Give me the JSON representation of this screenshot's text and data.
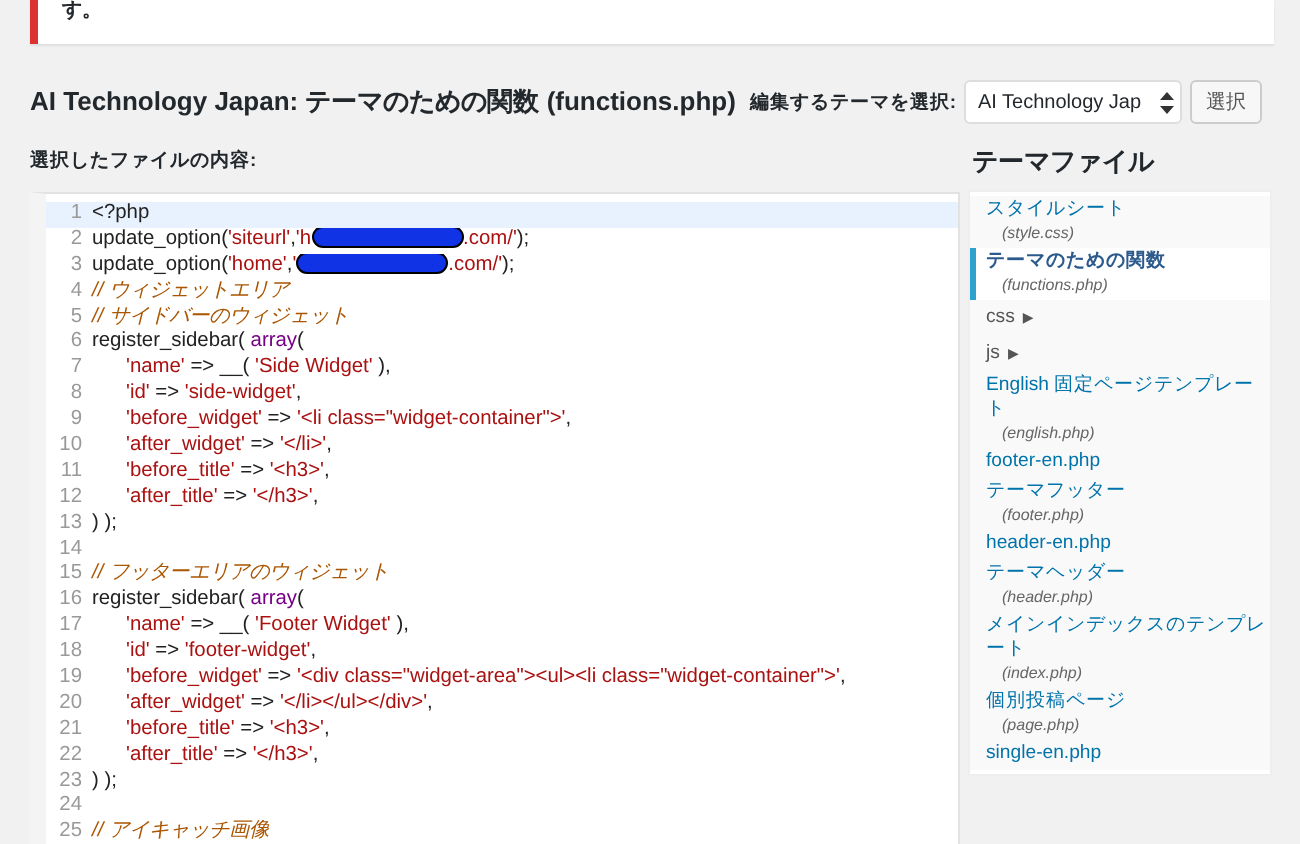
{
  "notice": {
    "text": "す。"
  },
  "title": "AI Technology Japan: テーマのための関数 (functions.php)",
  "theme_select": {
    "label": "編集するテーマを選択:",
    "value": "AI Technology Jap",
    "button": "選択"
  },
  "content_label": "選択したファイルの内容:",
  "editor": {
    "lines": [
      {
        "number": "1",
        "active": true,
        "indent": false,
        "segments": [
          {
            "kind": "plain",
            "text": "<?php"
          }
        ]
      },
      {
        "number": "2",
        "active": false,
        "indent": false,
        "segments": [
          {
            "kind": "plain",
            "text": "update_option("
          },
          {
            "kind": "string",
            "text": "'siteurl'"
          },
          {
            "kind": "plain",
            "text": ","
          },
          {
            "kind": "string",
            "text": "'h"
          },
          {
            "kind": "redaction"
          },
          {
            "kind": "string",
            "text": ".com/'"
          },
          {
            "kind": "plain",
            "text": ");"
          }
        ]
      },
      {
        "number": "3",
        "active": false,
        "indent": false,
        "segments": [
          {
            "kind": "plain",
            "text": "update_option("
          },
          {
            "kind": "string",
            "text": "'home'"
          },
          {
            "kind": "plain",
            "text": ","
          },
          {
            "kind": "string",
            "text": "'"
          },
          {
            "kind": "redaction"
          },
          {
            "kind": "string",
            "text": ".com/'"
          },
          {
            "kind": "plain",
            "text": ");"
          }
        ]
      },
      {
        "number": "4",
        "active": false,
        "indent": false,
        "segments": [
          {
            "kind": "comment",
            "text": "// ウィジェットエリア"
          }
        ]
      },
      {
        "number": "5",
        "active": false,
        "indent": false,
        "segments": [
          {
            "kind": "comment",
            "text": "// サイドバーのウィジェット"
          }
        ]
      },
      {
        "number": "6",
        "active": false,
        "indent": false,
        "segments": [
          {
            "kind": "plain",
            "text": "register_sidebar( "
          },
          {
            "kind": "keyword",
            "text": "array"
          },
          {
            "kind": "plain",
            "text": "("
          }
        ]
      },
      {
        "number": "7",
        "active": false,
        "indent": true,
        "segments": [
          {
            "kind": "string",
            "text": "'name'"
          },
          {
            "kind": "plain",
            "text": " => __( "
          },
          {
            "kind": "string",
            "text": "'Side Widget'"
          },
          {
            "kind": "plain",
            "text": " ),"
          }
        ]
      },
      {
        "number": "8",
        "active": false,
        "indent": true,
        "segments": [
          {
            "kind": "string",
            "text": "'id'"
          },
          {
            "kind": "plain",
            "text": " => "
          },
          {
            "kind": "string",
            "text": "'side-widget'"
          },
          {
            "kind": "plain",
            "text": ","
          }
        ]
      },
      {
        "number": "9",
        "active": false,
        "indent": true,
        "segments": [
          {
            "kind": "string",
            "text": "'before_widget'"
          },
          {
            "kind": "plain",
            "text": " => "
          },
          {
            "kind": "string",
            "text": "'<li class=\"widget-container\">'"
          },
          {
            "kind": "plain",
            "text": ","
          }
        ]
      },
      {
        "number": "10",
        "active": false,
        "indent": true,
        "segments": [
          {
            "kind": "string",
            "text": "'after_widget'"
          },
          {
            "kind": "plain",
            "text": " => "
          },
          {
            "kind": "string",
            "text": "'</li>'"
          },
          {
            "kind": "plain",
            "text": ","
          }
        ]
      },
      {
        "number": "11",
        "active": false,
        "indent": true,
        "segments": [
          {
            "kind": "string",
            "text": "'before_title'"
          },
          {
            "kind": "plain",
            "text": " => "
          },
          {
            "kind": "string",
            "text": "'<h3>'"
          },
          {
            "kind": "plain",
            "text": ","
          }
        ]
      },
      {
        "number": "12",
        "active": false,
        "indent": true,
        "segments": [
          {
            "kind": "string",
            "text": "'after_title'"
          },
          {
            "kind": "plain",
            "text": " => "
          },
          {
            "kind": "string",
            "text": "'</h3>'"
          },
          {
            "kind": "plain",
            "text": ","
          }
        ]
      },
      {
        "number": "13",
        "active": false,
        "indent": false,
        "segments": [
          {
            "kind": "plain",
            "text": ") );"
          }
        ]
      },
      {
        "number": "14",
        "active": false
      },
      {
        "number": "15",
        "active": false,
        "indent": false,
        "segments": [
          {
            "kind": "comment",
            "text": "// フッターエリアのウィジェット"
          }
        ]
      },
      {
        "number": "16",
        "active": false,
        "indent": false,
        "segments": [
          {
            "kind": "plain",
            "text": "register_sidebar( "
          },
          {
            "kind": "keyword",
            "text": "array"
          },
          {
            "kind": "plain",
            "text": "("
          }
        ]
      },
      {
        "number": "17",
        "active": false,
        "indent": true,
        "segments": [
          {
            "kind": "string",
            "text": "'name'"
          },
          {
            "kind": "plain",
            "text": " => __( "
          },
          {
            "kind": "string",
            "text": "'Footer Widget'"
          },
          {
            "kind": "plain",
            "text": " ),"
          }
        ]
      },
      {
        "number": "18",
        "active": false,
        "indent": true,
        "segments": [
          {
            "kind": "string",
            "text": "'id'"
          },
          {
            "kind": "plain",
            "text": " => "
          },
          {
            "kind": "string",
            "text": "'footer-widget'"
          },
          {
            "kind": "plain",
            "text": ","
          }
        ]
      },
      {
        "number": "19",
        "active": false,
        "indent": true,
        "segments": [
          {
            "kind": "string",
            "text": "'before_widget'"
          },
          {
            "kind": "plain",
            "text": " => "
          },
          {
            "kind": "string",
            "text": "'<div class=\"widget-area\"><ul><li class=\"widget-container\">'"
          },
          {
            "kind": "plain",
            "text": ","
          }
        ]
      },
      {
        "number": "20",
        "active": false,
        "indent": true,
        "segments": [
          {
            "kind": "string",
            "text": "'after_widget'"
          },
          {
            "kind": "plain",
            "text": " => "
          },
          {
            "kind": "string",
            "text": "'</li></ul></div>'"
          },
          {
            "kind": "plain",
            "text": ","
          }
        ]
      },
      {
        "number": "21",
        "active": false,
        "indent": true,
        "segments": [
          {
            "kind": "string",
            "text": "'before_title'"
          },
          {
            "kind": "plain",
            "text": " => "
          },
          {
            "kind": "string",
            "text": "'<h3>'"
          },
          {
            "kind": "plain",
            "text": ","
          }
        ]
      },
      {
        "number": "22",
        "active": false,
        "indent": true,
        "segments": [
          {
            "kind": "string",
            "text": "'after_title'"
          },
          {
            "kind": "plain",
            "text": " => "
          },
          {
            "kind": "string",
            "text": "'</h3>'"
          },
          {
            "kind": "plain",
            "text": ","
          }
        ]
      },
      {
        "number": "23",
        "active": false,
        "indent": false,
        "segments": [
          {
            "kind": "plain",
            "text": ") );"
          }
        ]
      },
      {
        "number": "24",
        "active": false
      },
      {
        "number": "25",
        "active": false,
        "indent": false,
        "segments": [
          {
            "kind": "comment",
            "text": "// アイキャッチ画像"
          }
        ]
      }
    ]
  },
  "theme_files": {
    "title": "テーマファイル",
    "items": [
      {
        "kind": "file",
        "label": "スタイルシート",
        "filename": "(style.css)",
        "selected": false
      },
      {
        "kind": "file",
        "label": "テーマのための関数",
        "filename": "(functions.php)",
        "selected": true
      },
      {
        "kind": "folder",
        "label": "css",
        "arrow": "▶",
        "selected": false
      },
      {
        "kind": "folder",
        "label": "js",
        "arrow": "▶",
        "selected": false
      },
      {
        "kind": "file",
        "label": "English 固定ページテンプレート",
        "filename": "(english.php)",
        "selected": false
      },
      {
        "kind": "file",
        "label": "footer-en.php",
        "selected": false
      },
      {
        "kind": "file",
        "label": "テーマフッター",
        "filename": "(footer.php)",
        "selected": false
      },
      {
        "kind": "file",
        "label": "header-en.php",
        "selected": false
      },
      {
        "kind": "file",
        "label": "テーマヘッダー",
        "filename": "(header.php)",
        "selected": false
      },
      {
        "kind": "file",
        "label": "メインインデックスのテンプレート",
        "filename": "(index.php)",
        "selected": false
      },
      {
        "kind": "file",
        "label": "個別投稿ページ",
        "filename": "(page.php)",
        "selected": false
      },
      {
        "kind": "file",
        "label": "single-en.php",
        "selected": false
      }
    ]
  }
}
